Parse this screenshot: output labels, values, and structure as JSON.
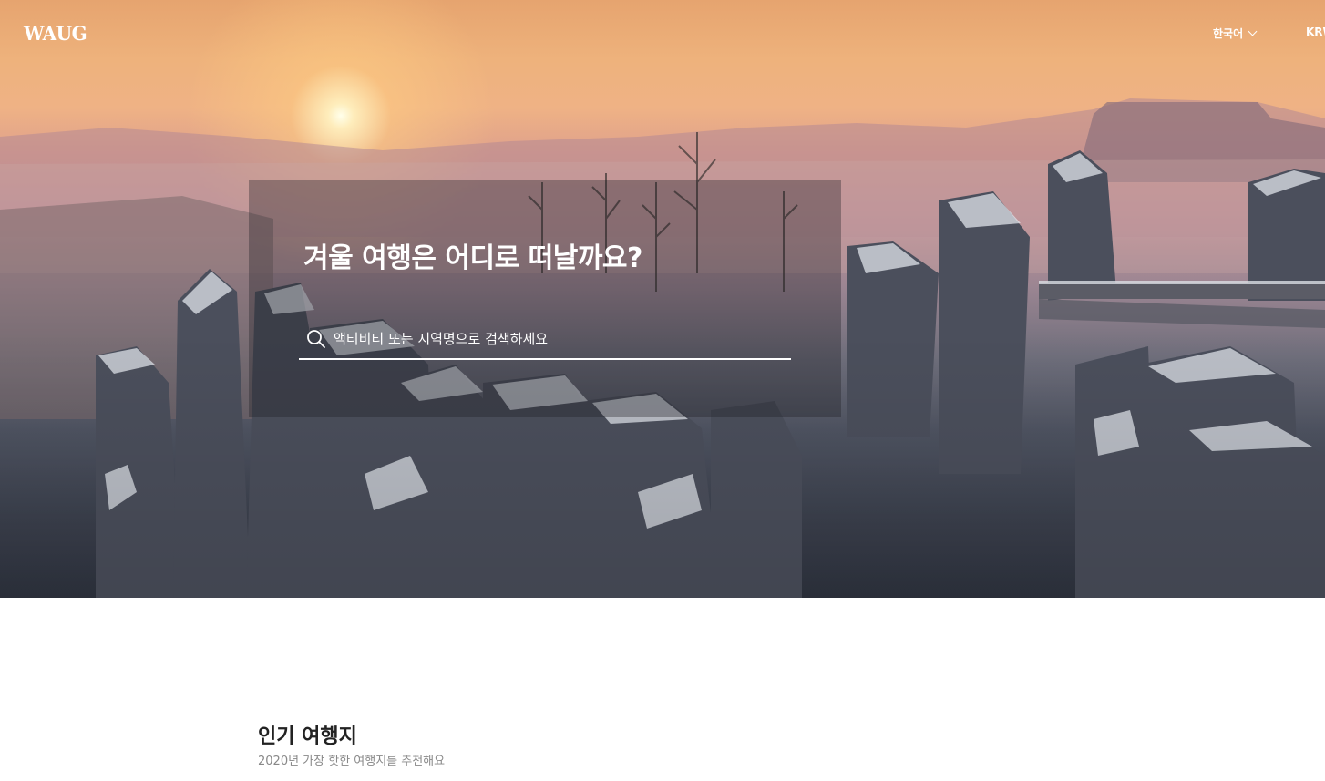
{
  "header": {
    "logo": "WAUG",
    "language": "한국어",
    "currency": "KRW"
  },
  "hero": {
    "title": "겨울 여행은 어디로 떠날까요?",
    "search_placeholder": "액티비티 또는 지역명으로 검색하세요",
    "search_value": ""
  },
  "section": {
    "title": "인기 여행지",
    "subtitle": "2020년 가장 핫한 여행지를 추천해요"
  },
  "icons": {
    "search": "search-icon",
    "language_dropdown": "chevron-down-icon"
  },
  "colors": {
    "text_white": "#ffffff",
    "section_title": "#222222",
    "section_subtitle": "#888888"
  }
}
